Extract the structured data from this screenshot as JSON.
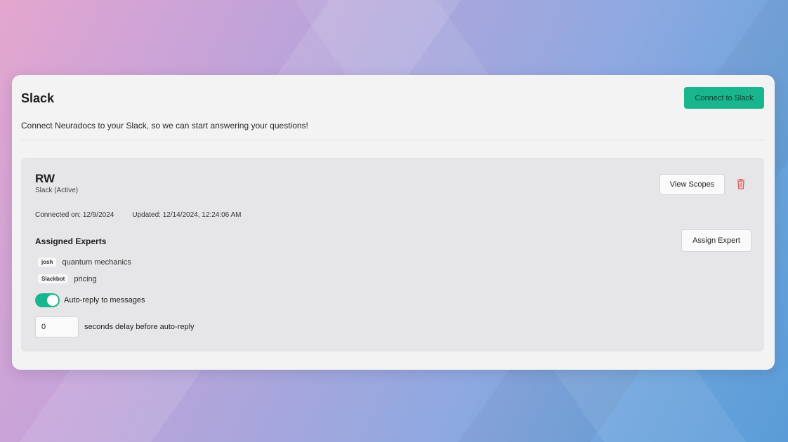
{
  "page": {
    "title": "Slack",
    "subtitle": "Connect Neuradocs to your Slack, so we can start answering your questions!",
    "connect_label": "Connect to Slack"
  },
  "integration": {
    "workspace": "RW",
    "status": "Slack (Active)",
    "view_scopes_label": "View Scopes",
    "connected_on": "Connected on: 12/9/2024",
    "updated": "Updated: 12/14/2024, 12:24:06 AM",
    "experts_title": "Assigned Experts",
    "assign_label": "Assign Expert",
    "experts": [
      {
        "name": "josh",
        "skill": "quantum mechanics"
      },
      {
        "name": "Slackbot",
        "skill": "pricing"
      }
    ],
    "auto_reply_label": "Auto-reply to messages",
    "auto_reply_on": true,
    "delay_value": "0",
    "delay_label": "seconds delay before auto-reply"
  },
  "colors": {
    "accent": "#19b58c",
    "delete": "#e05a5a"
  },
  "icons": {
    "delete": "trash-icon"
  }
}
